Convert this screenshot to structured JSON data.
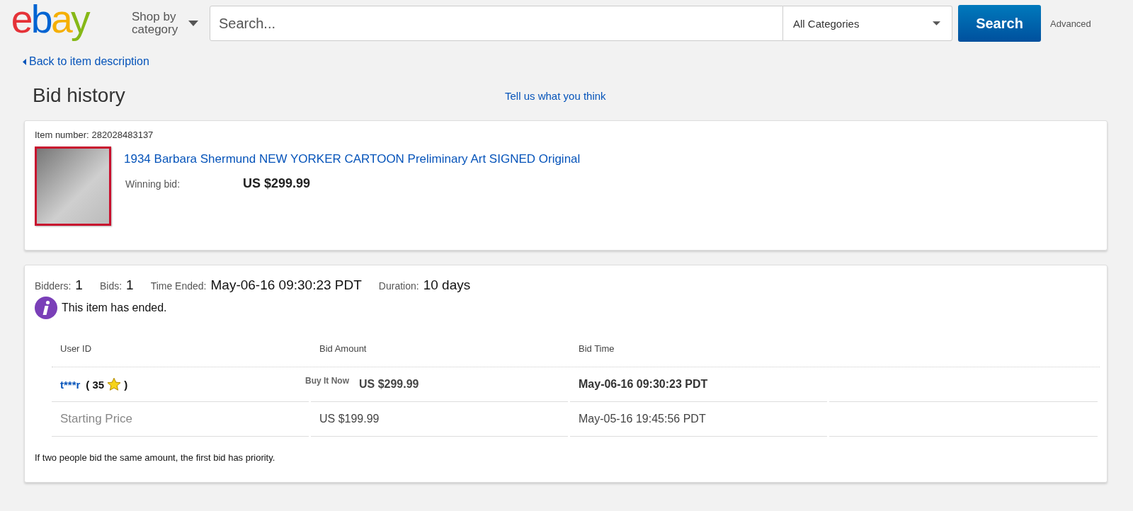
{
  "header": {
    "logo": "ebay",
    "shop_by_category": "Shop by category",
    "search": {
      "placeholder": "Search..."
    },
    "category_select": "All Categories",
    "search_button": "Search",
    "advanced_link": "Advanced"
  },
  "back_link": "Back to item description",
  "page_title": "Bid history",
  "feedback_link": "Tell us what you think",
  "item": {
    "item_number_label": "Item number:",
    "item_number": "282028483137",
    "title": "1934 Barbara Shermund NEW YORKER CARTOON Preliminary Art SIGNED Original",
    "winning_bid_label": "Winning bid:",
    "winning_bid": "US $299.99"
  },
  "summary": {
    "fields": [
      {
        "label": "Bidders:",
        "value": "1"
      },
      {
        "label": "Bids:",
        "value": "1"
      },
      {
        "label": "Time Ended:",
        "value": "May-06-16 09:30:23 PDT"
      },
      {
        "label": "Duration:",
        "value": "10 days"
      }
    ],
    "notice": "This item has ended."
  },
  "table": {
    "columns": [
      "User ID",
      "Bid Amount",
      "Bid Time"
    ],
    "rows": [
      {
        "kind": "bid",
        "user_id": "t***r",
        "feedback_before": "( 35",
        "feedback_after": ")",
        "bid_type": "Buy It Now",
        "amount": "US $299.99",
        "time": "May-06-16 09:30:23 PDT"
      },
      {
        "kind": "starting",
        "label": "Starting Price",
        "amount": "US $199.99",
        "time": "May-05-16 19:45:56 PDT"
      }
    ]
  },
  "footnote": "If two people bid the same amount, the first bid has priority."
}
